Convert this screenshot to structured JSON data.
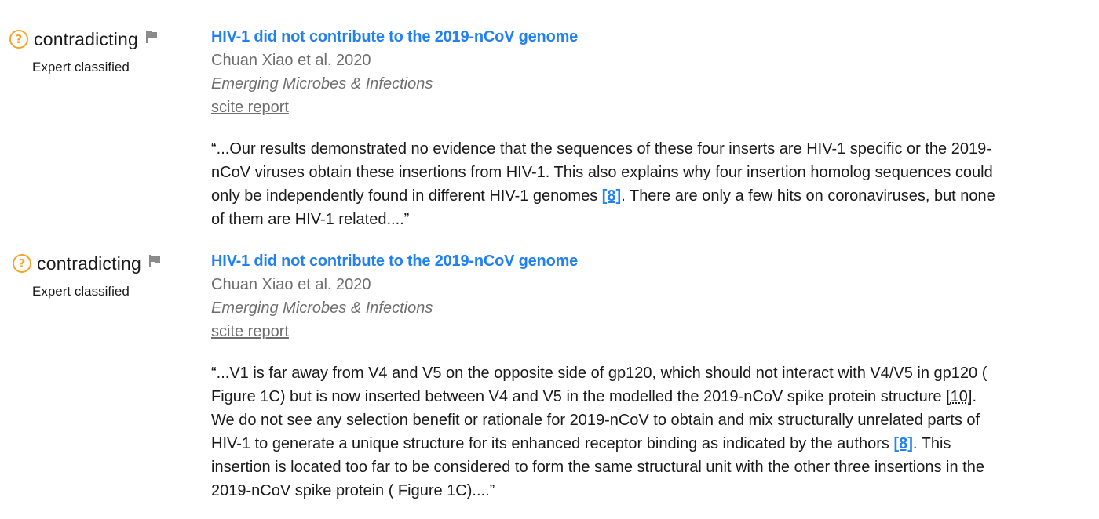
{
  "citations": [
    {
      "classification": "contradicting",
      "expert_label": "Expert classified",
      "title": "HIV-1 did not contribute to the 2019-nCoV genome",
      "authors": "Chuan Xiao et al. 2020",
      "journal": "Emerging Microbes & Infections",
      "report_link": "scite report",
      "excerpt": {
        "open_quote": "“...",
        "part1": "Our results demonstrated no evidence that the sequences of these four inserts are HIV-1 specific or the 2019-nCoV viruses obtain these insertions from HIV-1. This also explains why four insertion homolog sequences could only be independently found in different HIV-1 genomes ",
        "ref1": "[8]",
        "part2": ". There are only a few hits on coronaviruses, but none of them are HIV-1 related.",
        "close_quote": "...”"
      }
    },
    {
      "classification": "contradicting",
      "expert_label": "Expert classified",
      "title": "HIV-1 did not contribute to the 2019-nCoV genome",
      "authors": "Chuan Xiao et al. 2020",
      "journal": "Emerging Microbes & Infections",
      "report_link": "scite report",
      "excerpt": {
        "open_quote": "“...",
        "part1": "V1 is far away from V4 and V5 on the opposite side of gp120, which should not interact with V4/V5 in gp120 ( Figure 1C) but is now inserted between V4 and V5 in the modelled the 2019-nCoV spike protein structure ",
        "ref_plain": "[10]",
        "part2": ". We do not see any selection benefit or rationale for 2019-nCoV to obtain and mix structurally unrelated parts of HIV-1 to generate a unique structure for its enhanced receptor binding as indicated by the authors ",
        "ref1": "[8]",
        "part3": ". This insertion is located too far to be considered to form the same structural unit with the other three insertions in the 2019-nCoV spike protein ( Figure 1C).",
        "close_quote": "...”"
      }
    }
  ],
  "icons": {
    "classification": "question-circle-icon",
    "report": "flag-icon"
  },
  "colors": {
    "title": "#2181f0",
    "question_icon": "#f5a32b",
    "muted": "#6e6e6e",
    "flag": "#8a8a8a"
  }
}
